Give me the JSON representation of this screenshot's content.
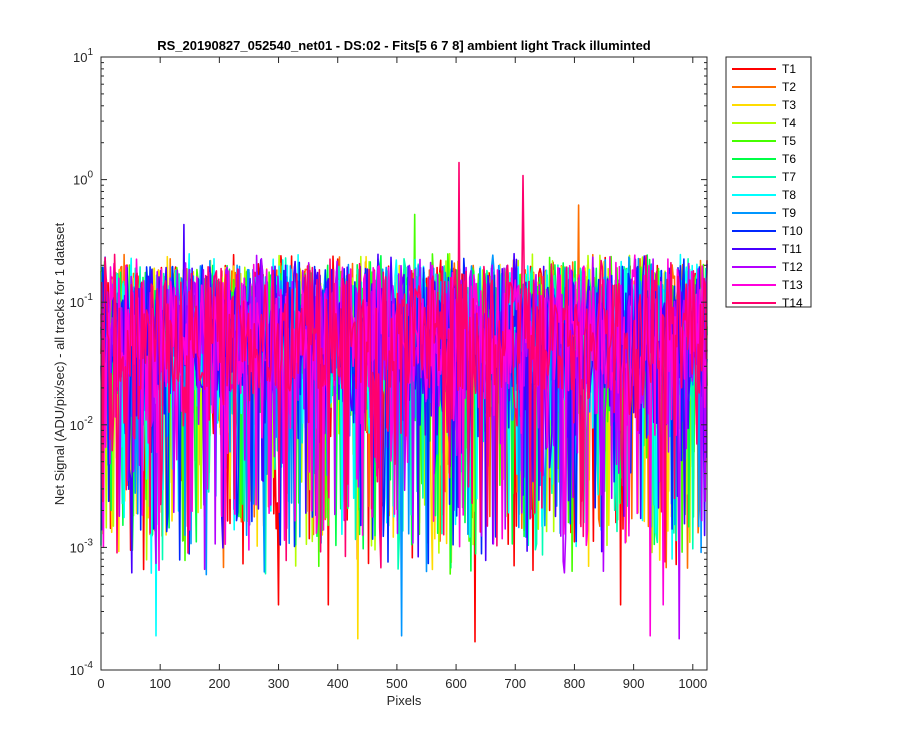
{
  "chart_data": {
    "type": "line",
    "title": "RS_20190827_052540_net01 - DS:02 - Fits[5  6  7  8]   ambient light   Track illuminted",
    "xlabel": "Pixels",
    "ylabel": "Net Signal (ADU/pix/sec) - all tracks for 1 dataset",
    "xlim": [
      0,
      1024
    ],
    "ylim": [
      0.0001,
      10
    ],
    "yscale": "log",
    "grid": false,
    "legend_position": "outside-top-right",
    "x_ticks": [
      "0",
      "100",
      "200",
      "300",
      "400",
      "500",
      "600",
      "700",
      "800",
      "900",
      "1000"
    ],
    "y_ticks": [
      {
        "base": "10",
        "exp": "-4"
      },
      {
        "base": "10",
        "exp": "-3"
      },
      {
        "base": "10",
        "exp": "-2"
      },
      {
        "base": "10",
        "exp": "-1"
      },
      {
        "base": "10",
        "exp": "0"
      },
      {
        "base": "10",
        "exp": "1"
      }
    ],
    "series": [
      {
        "name": "T1",
        "color": "#ff0000"
      },
      {
        "name": "T2",
        "color": "#ff6e00"
      },
      {
        "name": "T3",
        "color": "#ffdc00"
      },
      {
        "name": "T4",
        "color": "#b4ff00"
      },
      {
        "name": "T5",
        "color": "#46ff00"
      },
      {
        "name": "T6",
        "color": "#00ff46"
      },
      {
        "name": "T7",
        "color": "#00ffb4"
      },
      {
        "name": "T8",
        "color": "#00ffff"
      },
      {
        "name": "T9",
        "color": "#0096ff"
      },
      {
        "name": "T10",
        "color": "#0028ff"
      },
      {
        "name": "T11",
        "color": "#4600ff"
      },
      {
        "name": "T12",
        "color": "#b400ff"
      },
      {
        "name": "T13",
        "color": "#ff00dc"
      },
      {
        "name": "T14",
        "color": "#ff006e"
      }
    ],
    "peaks": [
      {
        "series": "T14",
        "x": 605,
        "y": 1.38
      },
      {
        "series": "T14",
        "x": 713,
        "y": 1.08
      },
      {
        "series": "T2",
        "x": 808,
        "y": 0.62
      },
      {
        "series": "T5",
        "x": 530,
        "y": 0.52
      },
      {
        "series": "T11",
        "x": 140,
        "y": 0.43
      }
    ],
    "troughs": [
      {
        "series": "T1",
        "x": 632,
        "y": 0.00017
      },
      {
        "series": "T3",
        "x": 435,
        "y": 0.00018
      },
      {
        "series": "T8",
        "x": 93,
        "y": 0.00019
      },
      {
        "series": "T9",
        "x": 508,
        "y": 0.00019
      },
      {
        "series": "T12",
        "x": 978,
        "y": 0.00018
      },
      {
        "series": "T13",
        "x": 928,
        "y": 0.00019
      },
      {
        "series": "T1",
        "x": 300,
        "y": 0.00034
      },
      {
        "series": "T1",
        "x": 385,
        "y": 0.00034
      },
      {
        "series": "T1",
        "x": 878,
        "y": 0.00034
      },
      {
        "series": "T13",
        "x": 950,
        "y": 0.00034
      }
    ],
    "band": {
      "low": 0.008,
      "high": 0.25,
      "typical": 0.06
    }
  }
}
